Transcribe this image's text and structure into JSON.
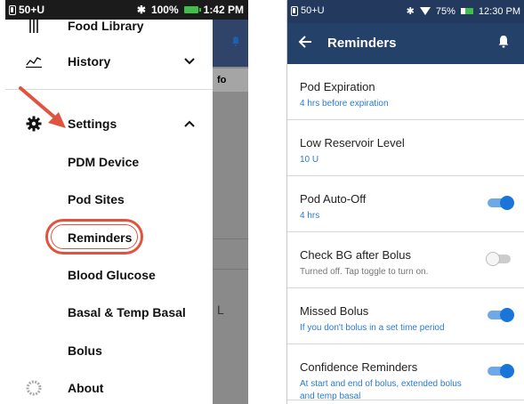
{
  "left_phone": {
    "status": {
      "carrier": "50+U",
      "battery": "100%",
      "time": "1:42 PM"
    },
    "backdrop_fragments": {
      "info_fragment": "fo",
      "letter_fragment": "L"
    },
    "menu": {
      "food_library": "Food Library",
      "history": "History",
      "settings": "Settings",
      "pdm_device": "PDM Device",
      "pod_sites": "Pod Sites",
      "reminders": "Reminders",
      "blood_glucose": "Blood Glucose",
      "basal_temp_basal": "Basal & Temp Basal",
      "bolus": "Bolus",
      "about": "About"
    },
    "icons": {
      "history": "chart-line-icon",
      "settings": "gear-icon",
      "about": "ring-icon",
      "food": "fork-icon"
    },
    "highlight_color": "#e0533f"
  },
  "right_phone": {
    "status": {
      "carrier": "50+U",
      "battery": "75%",
      "time": "12:30 PM"
    },
    "header": {
      "title": "Reminders"
    },
    "colors": {
      "header_bg": "#24416a",
      "accent": "#1a75d8",
      "subtext": "#2a7bd0"
    },
    "reminders": [
      {
        "name": "Pod Expiration",
        "detail": "4 hrs before expiration",
        "toggle": null
      },
      {
        "name": "Low Reservoir Level",
        "detail": "10 U",
        "toggle": null
      },
      {
        "name": "Pod Auto-Off",
        "detail": "4 hrs",
        "toggle": "on"
      },
      {
        "name": "Check BG after Bolus",
        "detail": "Turned off. Tap toggle to turn on.",
        "toggle": "off"
      },
      {
        "name": "Missed Bolus",
        "detail": "If you don't bolus in a set time period",
        "toggle": "on"
      },
      {
        "name": "Confidence Reminders",
        "detail": "At start and end of bolus, extended bolus and temp basal",
        "toggle": "on"
      }
    ]
  }
}
